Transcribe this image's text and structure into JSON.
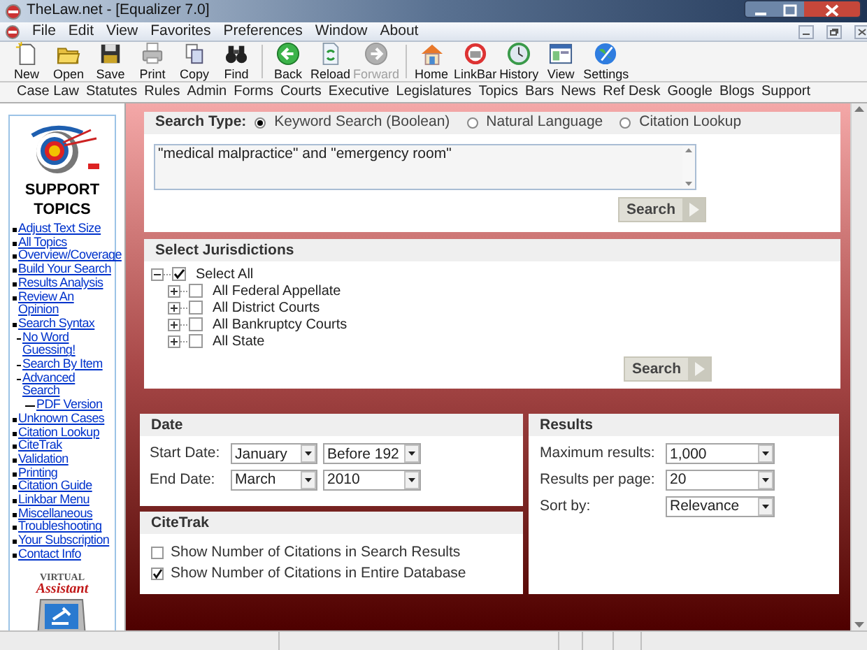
{
  "window": {
    "title": "TheLaw.net - [Equalizer 7.0]"
  },
  "menu": [
    "File",
    "Edit",
    "View",
    "Favorites",
    "Preferences",
    "Window",
    "About"
  ],
  "toolbar_groups": [
    {
      "buttons": [
        {
          "label": "New",
          "disabled": false
        },
        {
          "label": "Open",
          "disabled": false
        },
        {
          "label": "Save",
          "disabled": false
        },
        {
          "label": "Print",
          "disabled": false
        },
        {
          "label": "Copy",
          "disabled": false
        },
        {
          "label": "Find",
          "disabled": false
        }
      ]
    },
    {
      "buttons": [
        {
          "label": "Back",
          "disabled": false
        },
        {
          "label": "Reload",
          "disabled": false
        },
        {
          "label": "Forward",
          "disabled": true
        }
      ]
    },
    {
      "buttons": [
        {
          "label": "Home",
          "disabled": false
        },
        {
          "label": "LinkBar",
          "disabled": false
        },
        {
          "label": "History",
          "disabled": false
        },
        {
          "label": "View",
          "disabled": false
        },
        {
          "label": "Settings",
          "disabled": false
        }
      ]
    }
  ],
  "linkbar": [
    "Case Law",
    "Statutes",
    "Rules",
    "Admin",
    "Forms",
    "Courts",
    "Executive",
    "Legislatures",
    "Topics",
    "Bars",
    "News",
    "Ref Desk",
    "Google",
    "Blogs",
    "Support"
  ],
  "sidebar": {
    "title": "SUPPORT TOPICS",
    "topics": [
      {
        "label": "Adjust Text Size"
      },
      {
        "label": "All Topics"
      },
      {
        "label": "Overview/Coverage"
      },
      {
        "label": "Build Your Search"
      },
      {
        "label": "Results Analysis"
      },
      {
        "label": "Review An Opinion"
      },
      {
        "label": "Search Syntax",
        "children": [
          {
            "label": "No Word Guessing!"
          },
          {
            "label": "Search By Item"
          },
          {
            "label": "Advanced Search",
            "children": [
              {
                "label": "PDF Version"
              }
            ]
          }
        ]
      },
      {
        "label": "Unknown Cases"
      },
      {
        "label": "Citation Lookup"
      },
      {
        "label": "CiteTrak"
      },
      {
        "label": "Validation"
      },
      {
        "label": "Printing"
      },
      {
        "label": "Citation Guide"
      },
      {
        "label": "Linkbar Menu"
      },
      {
        "label": "Miscellaneous"
      },
      {
        "label": "Troubleshooting"
      },
      {
        "label": "Your Subscription"
      },
      {
        "label": "Contact Info"
      }
    ],
    "assistant": {
      "label_top": "VIRTUAL",
      "label": "Assistant"
    }
  },
  "search": {
    "type_label": "Search Type:",
    "types": [
      {
        "label": "Keyword Search (Boolean)",
        "selected": true
      },
      {
        "label": "Natural Language",
        "selected": false
      },
      {
        "label": "Citation Lookup",
        "selected": false
      }
    ],
    "query": "\"medical malpractice\" and \"emergency room\"",
    "button": "Search"
  },
  "jurisdictions": {
    "title": "Select Jurisdictions",
    "tree": [
      {
        "label": "Select All",
        "checked": true,
        "expanded": true,
        "children": [
          {
            "label": "All Federal Appellate",
            "checked": false,
            "expanded": false
          },
          {
            "label": "All District Courts",
            "checked": false,
            "expanded": false
          },
          {
            "label": "All Bankruptcy Courts",
            "checked": false,
            "expanded": false
          },
          {
            "label": "All State",
            "checked": false,
            "expanded": false
          }
        ]
      }
    ],
    "button": "Search"
  },
  "date": {
    "title": "Date",
    "rows": [
      {
        "label": "Start Date:",
        "month": "January",
        "year": "Before 192"
      },
      {
        "label": "End Date:",
        "month": "March",
        "year": "2010"
      }
    ]
  },
  "citetrak": {
    "title": "CiteTrak",
    "options": [
      {
        "label": "Show Number of Citations in Search Results",
        "checked": false
      },
      {
        "label": "Show Number of Citations in Entire Database",
        "checked": true
      }
    ]
  },
  "results": {
    "title": "Results",
    "fields": [
      {
        "label": "Maximum results:",
        "value": "1,000"
      },
      {
        "label": "Results per page:",
        "value": "20"
      },
      {
        "label": "Sort by:",
        "value": "Relevance"
      }
    ]
  }
}
